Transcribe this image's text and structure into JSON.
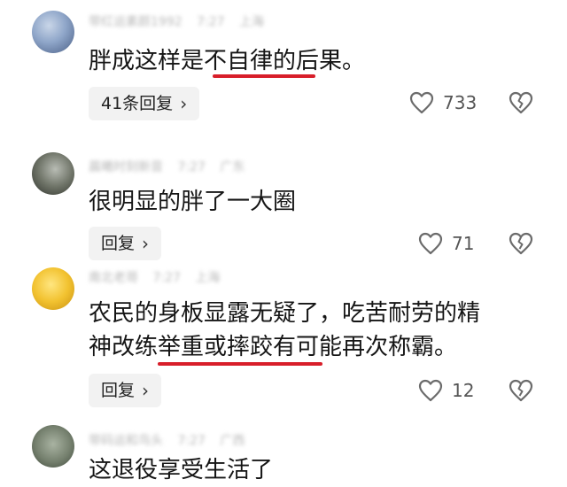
{
  "comments": [
    {
      "meta": {
        "user": "带红运素颜1992",
        "time": "7:27",
        "location": "上海"
      },
      "text_lines": [
        {
          "before": "胖成这样是",
          "mark": "不自律的",
          "after": "后果。"
        }
      ],
      "reply_label": "41条回复",
      "likes": "733"
    },
    {
      "meta": {
        "user": "晨曦时刻新音",
        "time": "7:27",
        "location": "广东"
      },
      "text_lines": [
        {
          "before": "很明显的胖了一大圈",
          "mark": "",
          "after": ""
        }
      ],
      "reply_label": "回复",
      "likes": "71"
    },
    {
      "meta": {
        "user": "南北老哥",
        "time": "7:27",
        "location": "上海"
      },
      "text_lines": [
        {
          "before": "农民的身板显露无疑了，吃苦耐劳的精",
          "mark": "",
          "after": ""
        },
        {
          "before": "神改",
          "mark": "练举重或摔跤有",
          "after": "可能再次称霸。"
        }
      ],
      "reply_label": "回复",
      "likes": "12"
    },
    {
      "meta": {
        "user": "带码运和鸟头",
        "time": "7:27",
        "location": "广西"
      },
      "text_lines": [
        {
          "before": "这退役享受生活了",
          "mark": "",
          "after": ""
        }
      ]
    }
  ],
  "colors": {
    "underline": "#d81e2a",
    "reply_bg": "#f2f2f2",
    "meta": "#b8b8b8"
  },
  "icons": {
    "like": "heart-outline-icon",
    "dislike": "broken-heart-icon",
    "reply_chevron": "chevron-right-icon"
  }
}
